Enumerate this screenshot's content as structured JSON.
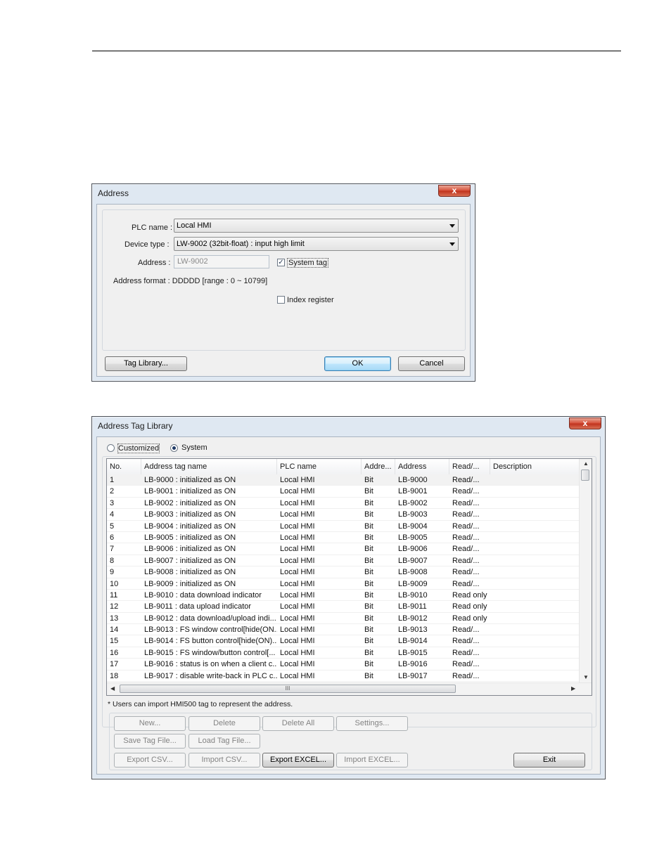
{
  "address_dialog": {
    "title": "Address",
    "close_label": "x",
    "plc_name_label": "PLC name :",
    "plc_name_value": "Local HMI",
    "device_type_label": "Device type :",
    "device_type_value": "LW-9002 (32bit-float) : input high limit",
    "address_label": "Address :",
    "address_value": "LW-9002",
    "system_tag_label": "System tag",
    "system_tag_checked": true,
    "address_format": "Address format : DDDDD [range : 0 ~ 10799]",
    "index_register_label": "Index register",
    "index_register_checked": false,
    "tag_library_button": "Tag Library...",
    "ok_button": "OK",
    "cancel_button": "Cancel"
  },
  "tag_library": {
    "title": "Address Tag Library",
    "close_label": "x",
    "radio_customized": "Customized",
    "radio_system": "System",
    "selected_radio": "System",
    "columns": [
      "No.",
      "Address tag name",
      "PLC name",
      "Addre...",
      "Address",
      "Read/...",
      "Description"
    ],
    "rows": [
      [
        "1",
        "LB-9000 : initialized as ON",
        "Local HMI",
        "Bit",
        "LB-9000",
        "Read/...",
        ""
      ],
      [
        "2",
        "LB-9001 : initialized as ON",
        "Local HMI",
        "Bit",
        "LB-9001",
        "Read/...",
        ""
      ],
      [
        "3",
        "LB-9002 : initialized as ON",
        "Local HMI",
        "Bit",
        "LB-9002",
        "Read/...",
        ""
      ],
      [
        "4",
        "LB-9003 : initialized as ON",
        "Local HMI",
        "Bit",
        "LB-9003",
        "Read/...",
        ""
      ],
      [
        "5",
        "LB-9004 : initialized as ON",
        "Local HMI",
        "Bit",
        "LB-9004",
        "Read/...",
        ""
      ],
      [
        "6",
        "LB-9005 : initialized as ON",
        "Local HMI",
        "Bit",
        "LB-9005",
        "Read/...",
        ""
      ],
      [
        "7",
        "LB-9006 : initialized as ON",
        "Local HMI",
        "Bit",
        "LB-9006",
        "Read/...",
        ""
      ],
      [
        "8",
        "LB-9007 : initialized as ON",
        "Local HMI",
        "Bit",
        "LB-9007",
        "Read/...",
        ""
      ],
      [
        "9",
        "LB-9008 : initialized as ON",
        "Local HMI",
        "Bit",
        "LB-9008",
        "Read/...",
        ""
      ],
      [
        "10",
        "LB-9009 : initialized as ON",
        "Local HMI",
        "Bit",
        "LB-9009",
        "Read/...",
        ""
      ],
      [
        "11",
        "LB-9010 : data download indicator",
        "Local HMI",
        "Bit",
        "LB-9010",
        "Read only",
        ""
      ],
      [
        "12",
        "LB-9011 : data upload indicator",
        "Local HMI",
        "Bit",
        "LB-9011",
        "Read only",
        ""
      ],
      [
        "13",
        "LB-9012 : data download/upload indi...",
        "Local HMI",
        "Bit",
        "LB-9012",
        "Read only",
        ""
      ],
      [
        "14",
        "LB-9013 : FS window control[hide(ON...",
        "Local HMI",
        "Bit",
        "LB-9013",
        "Read/...",
        ""
      ],
      [
        "15",
        "LB-9014 : FS button control[hide(ON)...",
        "Local HMI",
        "Bit",
        "LB-9014",
        "Read/...",
        ""
      ],
      [
        "16",
        "LB-9015 : FS window/button control[...",
        "Local HMI",
        "Bit",
        "LB-9015",
        "Read/...",
        ""
      ],
      [
        "17",
        "LB-9016 : status is on when a client c...",
        "Local HMI",
        "Bit",
        "LB-9016",
        "Read/...",
        ""
      ],
      [
        "18",
        "LB-9017 : disable write-back in PLC c...",
        "Local HMI",
        "Bit",
        "LB-9017",
        "Read/...",
        ""
      ]
    ],
    "hscroll_grip": "III",
    "note": "* Users can import HMI500 tag to represent the address.",
    "buttons": {
      "new": "New...",
      "delete": "Delete",
      "delete_all": "Delete All",
      "settings": "Settings...",
      "save_tag_file": "Save Tag File...",
      "load_tag_file": "Load Tag File...",
      "export_csv": "Export CSV...",
      "import_csv": "Import CSV...",
      "export_excel": "Export EXCEL...",
      "import_excel": "Import EXCEL...",
      "exit": "Exit"
    }
  }
}
